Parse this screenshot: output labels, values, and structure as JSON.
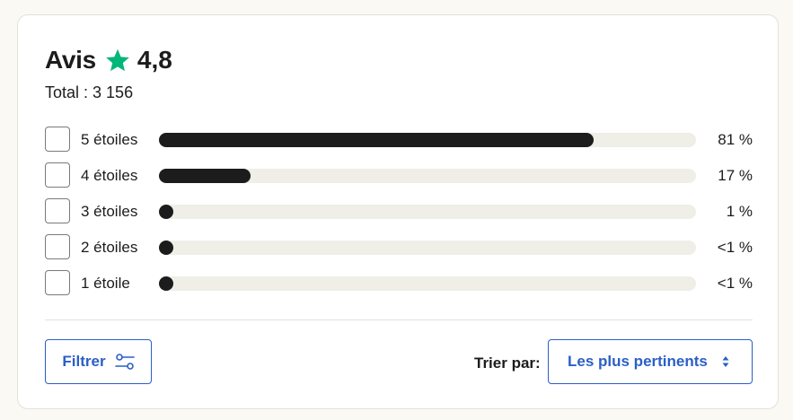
{
  "reviews": {
    "title": "Avis",
    "rating": "4,8",
    "star_icon": "star-icon",
    "star_color": "#00b67a",
    "total_label": "Total :",
    "total_value": "3 156"
  },
  "distribution": [
    {
      "label": "5 étoiles",
      "percent_text": "81 %",
      "fill_fraction": 0.81
    },
    {
      "label": "4 étoiles",
      "percent_text": "17 %",
      "fill_fraction": 0.17
    },
    {
      "label": "3 étoiles",
      "percent_text": "1 %",
      "fill_fraction": 0.01
    },
    {
      "label": "2 étoiles",
      "percent_text": "<1 %",
      "fill_fraction": 0.005
    },
    {
      "label": "1 étoile",
      "percent_text": "<1 %",
      "fill_fraction": 0.005
    }
  ],
  "controls": {
    "filter_label": "Filtrer",
    "filter_icon": "sliders-icon",
    "sort_label": "Trier par:",
    "sort_value": "Les plus pertinents",
    "sort_icon": "sort-arrows-icon",
    "accent_color": "#2a5fc7"
  }
}
